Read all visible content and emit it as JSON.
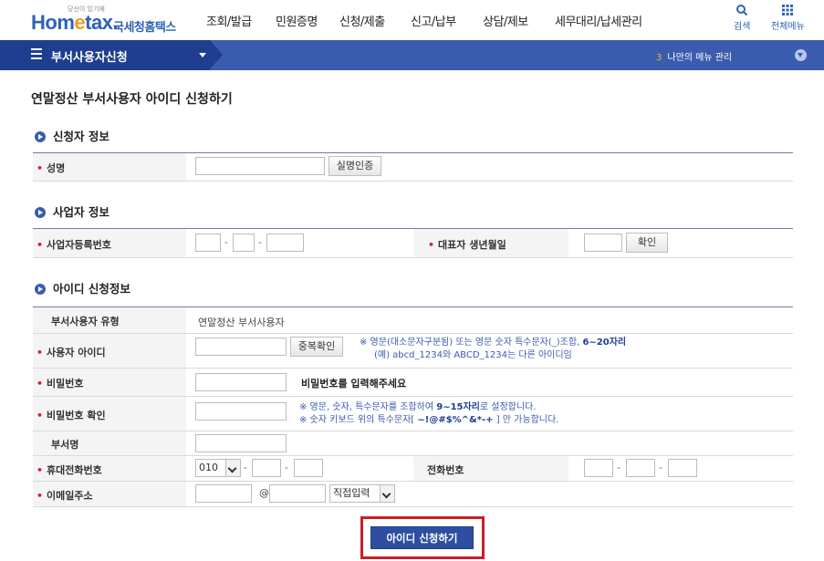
{
  "header": {
    "logo_tag": "당신이 있기에",
    "logo_main_a": "Hom",
    "logo_main_e": "e",
    "logo_main_b": "tax.",
    "logo_sub": "국세청홈택스",
    "menu": [
      "조회/발급",
      "민원증명",
      "신청/제출",
      "신고/납부",
      "상담/제보",
      "세무대리/납세관리"
    ],
    "search_label": "검색",
    "allmenu_label": "전체메뉴"
  },
  "navbar": {
    "title": "부서사용자신청",
    "my_menu_count": "3",
    "my_menu_label": "나만의 메뉴 관리"
  },
  "page_title": "연말정산 부서사용자 아이디 신청하기",
  "applicant": {
    "section": "신청자 정보",
    "name_label": "성명",
    "verify_button": "실명인증"
  },
  "business": {
    "section": "사업자 정보",
    "regno_label": "사업자등록번호",
    "rep_birth_label": "대표자 생년월일",
    "confirm_button": "확인"
  },
  "id_info": {
    "section": "아이디 신청정보",
    "user_type_label": "부서사용자 유형",
    "user_type_value": "연말정산 부서사용자",
    "user_id_label": "사용자 아이디",
    "dup_button": "중복확인",
    "id_note_1a": "※ 영문(대소문자구분됨) 또는 영문 숫자 특수문자(_)조합, ",
    "id_note_1b": "6~20자리",
    "id_note_2": "(예) abcd_1234와 ABCD_1234는 다른 아이디임",
    "password_label": "비밀번호",
    "password_hint": "비밀번호를 입력해주세요",
    "password_confirm_label": "비밀번호 확인",
    "pw_note_1a": "※ 영문, 숫자, 특수문자를 조합하여 ",
    "pw_note_1b": "9~15자리",
    "pw_note_1c": "로 설정합니다.",
    "pw_note_2a": "※ 숫자 키보드 위의 특수문자[ ",
    "pw_note_2b": "~!@#$%^&*-+",
    "pw_note_2c": " ] 만 가능합니다.",
    "dept_label": "부서명",
    "mobile_label": "휴대전화번호",
    "mobile_prefix": "010",
    "phone_label": "전화번호",
    "email_label": "이메일주소",
    "email_at": "@",
    "email_domain_select": "직접입력"
  },
  "apply_button": "아이디 신청하기"
}
